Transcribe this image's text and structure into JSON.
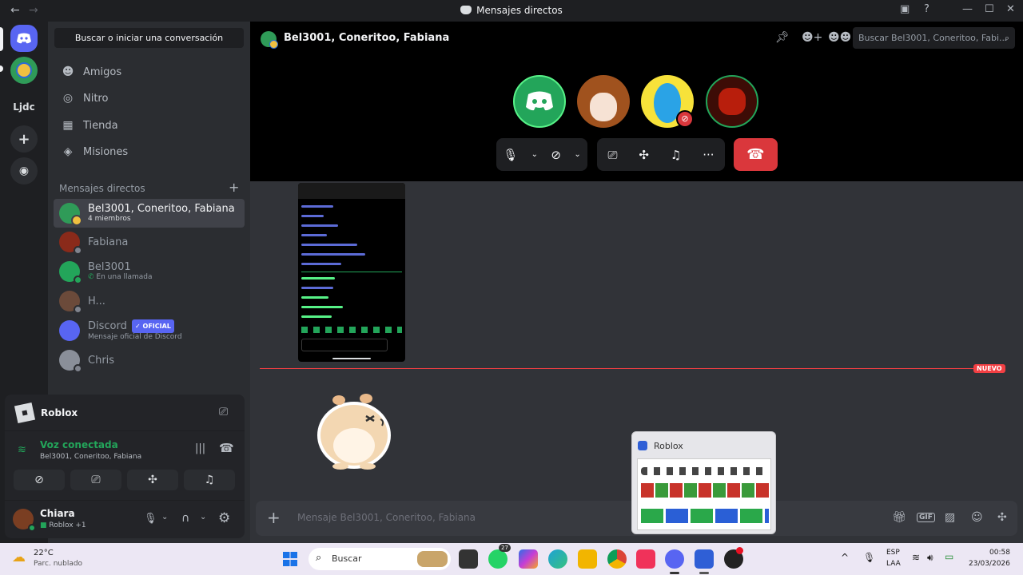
{
  "window": {
    "title": "Mensajes directos"
  },
  "servers": {
    "guild_label": "Ljdc"
  },
  "sidebar": {
    "search_button": "Buscar o iniciar una conversación",
    "nav": [
      {
        "label": "Amigos",
        "icon": "friends-icon"
      },
      {
        "label": "Nitro",
        "icon": "nitro-icon"
      },
      {
        "label": "Tienda",
        "icon": "shop-icon"
      },
      {
        "label": "Misiones",
        "icon": "quests-icon"
      }
    ],
    "dm_header": "Mensajes directos",
    "dms": [
      {
        "name": "Bel3001, Coneritoo, Fabiana",
        "sub": "4 miembros"
      },
      {
        "name": "Fabiana",
        "sub": ""
      },
      {
        "name": "Bel3001",
        "sub": "En una llamada"
      },
      {
        "name": "H...",
        "sub": ""
      },
      {
        "name": "Discord",
        "badge": "OFICIAL",
        "sub": "Mensaje oficial de Discord"
      },
      {
        "name": "Chris",
        "sub": ""
      }
    ]
  },
  "voice_panel": {
    "game": "Roblox",
    "status": "Voz conectada",
    "channel": "Bel3001, Coneritoo, Fabiana",
    "user": {
      "name": "Chiara",
      "activity": "Roblox +1"
    }
  },
  "header": {
    "channel_title": "Bel3001, Coneritoo, Fabiana",
    "search_placeholder": "Buscar Bel3001, Coneritoo, Fabi..."
  },
  "chat": {
    "new_badge": "NUEVO",
    "composer_placeholder": "Mensaje Bel3001, Coneritoo, Fabiana"
  },
  "thumbnail": {
    "title": "Roblox"
  },
  "taskbar": {
    "weather_temp": "22°C",
    "weather_desc": "Parc. nublado",
    "search": "Buscar",
    "whatsapp_badge": "27",
    "lang": "ESP",
    "lang_sub": "LAA",
    "time": "00:58",
    "date": "23/03/2026"
  },
  "colors": {
    "blurple": "#5865f2",
    "danger": "#da373c",
    "online": "#23a55a"
  }
}
